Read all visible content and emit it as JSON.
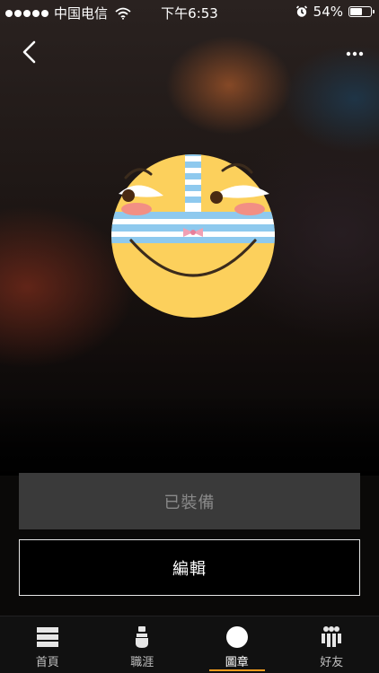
{
  "status_bar": {
    "carrier": "中国电信",
    "time": "下午6:53",
    "battery_percent_label": "54%",
    "battery_level": 0.54
  },
  "nav": {
    "back_icon": "chevron-left-icon",
    "more_icon": "more-horizontal-icon"
  },
  "badge": {
    "icon": "smiley-face-badge",
    "colors": {
      "face": "#fcd05c",
      "stripe_blue": "#8ec9ee",
      "stripe_white": "#ffffff",
      "blush": "#f28f84",
      "outline": "#3b2b1c"
    }
  },
  "actions": {
    "equipped_label": "已裝備",
    "edit_label": "編輯"
  },
  "tab_bar": {
    "accent": "#f39c1f",
    "tabs": [
      {
        "label": "首頁",
        "icon": "home-icon",
        "active": false
      },
      {
        "label": "職涯",
        "icon": "career-icon",
        "active": false
      },
      {
        "label": "圖章",
        "icon": "badge-icon",
        "active": true
      },
      {
        "label": "好友",
        "icon": "friends-icon",
        "active": false
      }
    ]
  }
}
